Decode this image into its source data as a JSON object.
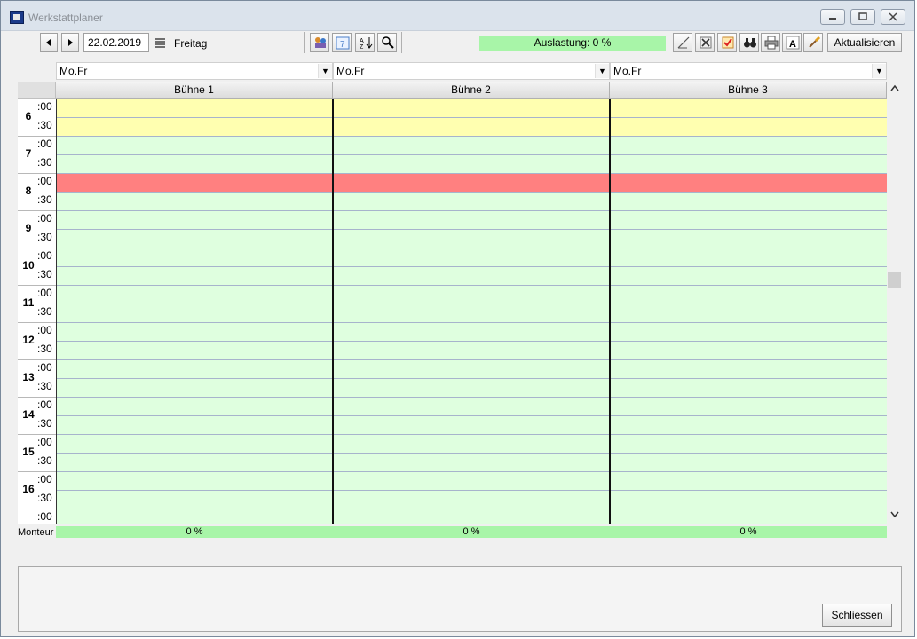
{
  "window": {
    "title": "Werkstattplaner",
    "controls": {
      "minimize": "▭",
      "maximize": "▢",
      "close": "✕"
    }
  },
  "toolbar": {
    "prev_icon": "triangle-left-icon",
    "next_icon": "triangle-right-icon",
    "date": "22.02.2019",
    "weekday": "Freitag",
    "load_label": "Auslastung: 0 %",
    "refresh_label": "Aktualisieren",
    "tool_icons": [
      "people-icon",
      "calendar-icon",
      "sort-icon",
      "search-icon"
    ],
    "action_icons": [
      "edit-icon",
      "delete-icon",
      "checklist-icon",
      "binoculars-icon",
      "print-icon",
      "font-icon",
      "brush-icon"
    ]
  },
  "columns": [
    {
      "filter": "Mo.Fr",
      "label": "Bühne 1",
      "utilization": "0 %"
    },
    {
      "filter": "Mo.Fr",
      "label": "Bühne 2",
      "utilization": "0 %"
    },
    {
      "filter": "Mo.Fr",
      "label": "Bühne 3",
      "utilization": "0 %"
    }
  ],
  "time_rows": [
    {
      "hour": "6",
      "m1": ":00",
      "m2": ":30"
    },
    {
      "hour": "7",
      "m1": ":00",
      "m2": ":30"
    },
    {
      "hour": "8",
      "m1": ":00",
      "m2": ":30"
    },
    {
      "hour": "9",
      "m1": ":00",
      "m2": ":30"
    },
    {
      "hour": "10",
      "m1": ":00",
      "m2": ":30"
    },
    {
      "hour": "11",
      "m1": ":00",
      "m2": ":30"
    },
    {
      "hour": "12",
      "m1": ":00",
      "m2": ":30"
    },
    {
      "hour": "13",
      "m1": ":00",
      "m2": ":30"
    },
    {
      "hour": "14",
      "m1": ":00",
      "m2": ":30"
    },
    {
      "hour": "15",
      "m1": ":00",
      "m2": ":30"
    },
    {
      "hour": "16",
      "m1": ":00",
      "m2": ":30"
    },
    {
      "hour": "",
      "m1": ":00",
      "m2": ""
    }
  ],
  "slot_colors": {
    "open": "#dfffdf",
    "closed": "#ffffb0",
    "break": "#ff8080",
    "states": [
      "closed",
      "closed",
      "open",
      "open",
      "break",
      "open",
      "open",
      "open",
      "open",
      "open",
      "open",
      "open",
      "open",
      "open",
      "open",
      "open",
      "open",
      "open",
      "open",
      "open",
      "open",
      "open",
      "open"
    ]
  },
  "footer": {
    "monteur_label": "Monteur"
  },
  "close_label": "Schliessen",
  "scrollbar": {
    "up": "▲",
    "down": "▼"
  }
}
